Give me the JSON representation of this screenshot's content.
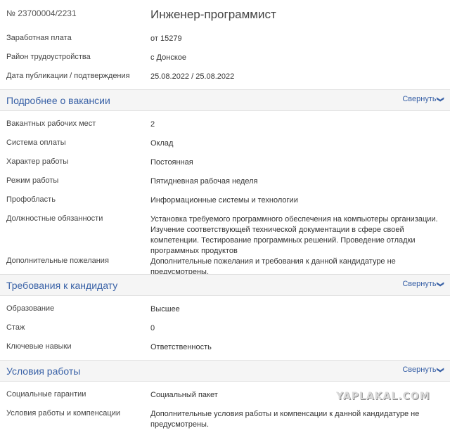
{
  "vacancy": {
    "number": "№ 23700004/2231",
    "title": "Инженер-программист"
  },
  "summary": [
    {
      "label": "Заработная плата",
      "value": "от 15279"
    },
    {
      "label": "Район трудоустройства",
      "value": "с Донское"
    },
    {
      "label": "Дата публикации / подтверждения",
      "value": "25.08.2022 / 25.08.2022"
    }
  ],
  "collapse_label": "Свернуть",
  "sections": [
    {
      "title": "Подробнее о вакансии",
      "rows": [
        {
          "label": "Вакантных рабочих мест",
          "value": "2"
        },
        {
          "label": "Система оплаты",
          "value": "Оклад"
        },
        {
          "label": "Характер работы",
          "value": "Постоянная"
        },
        {
          "label": "Режим работы",
          "value": "Пятидневная рабочая неделя"
        },
        {
          "label": "Профобласть",
          "value": "Информационные системы и технологии"
        },
        {
          "label": "Должностные обязанности",
          "value": "Установка требуемого программного обеспечения на компьютеры организации. Изучение соответствующей технической документации в сфере своей компетенции. Тестирование программных решений. Проведение отладки программных продуктов"
        },
        {
          "label": "Дополнительные пожелания",
          "value": "Дополнительные пожелания и требования к данной кандидатуре не предусмотрены."
        }
      ]
    },
    {
      "title": "Требования к кандидату",
      "rows": [
        {
          "label": "Образование",
          "value": "Высшее"
        },
        {
          "label": "Стаж",
          "value": "0"
        },
        {
          "label": "Ключевые навыки",
          "value": "Ответственность"
        }
      ]
    },
    {
      "title": "Условия работы",
      "rows": [
        {
          "label": "Социальные гарантии",
          "value": "Социальный пакет"
        },
        {
          "label": "Условия работы и компенсации",
          "value": "Дополнительные условия работы и компенсации к данной кандидатуре не предусмотрены."
        }
      ]
    }
  ],
  "watermark": "YAPLAKAL.COM",
  "colors": {
    "accent": "#3a62a7",
    "section_bg": "#f5f5f5"
  }
}
